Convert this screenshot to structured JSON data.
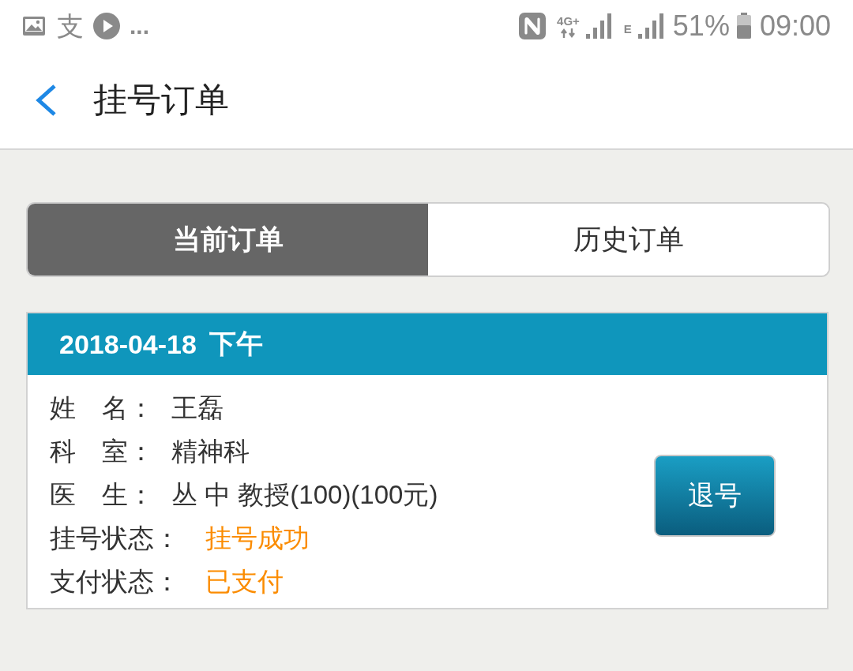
{
  "status_bar": {
    "notification_glyph": "支",
    "overflow": "...",
    "network_type": "4G+",
    "network_type_secondary": "E",
    "battery": "51%",
    "time": "09:00"
  },
  "header": {
    "title": "挂号订单"
  },
  "tabs": [
    {
      "label": "当前订单",
      "selected": true
    },
    {
      "label": "历史订单",
      "selected": false
    }
  ],
  "orders": [
    {
      "date": "2018-04-18",
      "period": "下午",
      "fields": [
        {
          "kind": "text",
          "label": "姓　名：",
          "value": "王磊"
        },
        {
          "kind": "text",
          "label": "科　室：",
          "value": "精神科"
        },
        {
          "kind": "text",
          "label": "医　生：",
          "value": "丛 中 教授(100)(100元)"
        },
        {
          "kind": "status",
          "label": "挂号状态：",
          "value": "挂号成功"
        },
        {
          "kind": "status",
          "label": "支付状态：",
          "value": "已支付"
        }
      ],
      "button": "退号"
    }
  ]
}
